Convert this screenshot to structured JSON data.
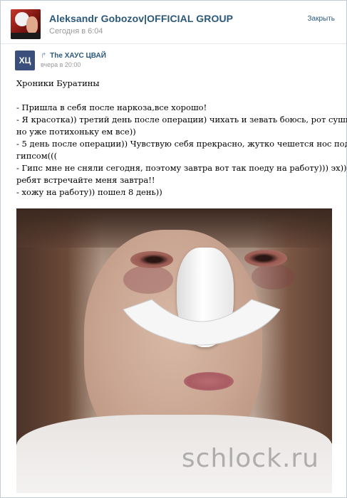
{
  "group": {
    "name": "Aleksandr Gobozov|OFFICIAL GROUP",
    "time": "Сегодня в 6:04",
    "close_label": "Закрыть",
    "avatar_icon": "group-avatar-image"
  },
  "repost": {
    "share_icon": "repost-arrow-icon",
    "source_name": "The ХАУС ЦВАЙ",
    "source_avatar_text": "ХЦ",
    "source_time": "вчера в 20:00"
  },
  "post": {
    "title": "Хроники Буратины",
    "lines": [
      "- Пришла в себя после наркоза,все хорошо!",
      "- Я красотка)) третий день после операции) чихать и зевать боюсь, рот сушит,",
      "но уже потихоньку ем все))",
      "- 5 день после операции)) Чувствую себя прекрасно, жутко чешется нос под",
      "гипсом(((",
      "- Гипс мне не сняли сегодня, поэтому завтра вот так поеду на работу))) эх)))",
      "ребят встречайте меня завтра!!",
      "- хожу на работу)) пошел 8 день))"
    ]
  },
  "photo": {
    "watermark": "schlock.ru"
  },
  "colors": {
    "link": "#2b587a",
    "muted": "#999999",
    "border": "#c3cbd4"
  }
}
